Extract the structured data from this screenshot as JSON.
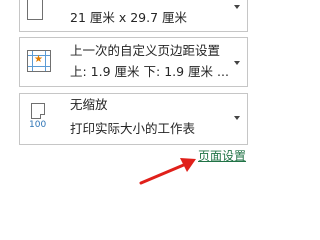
{
  "paper_size": {
    "line1": "21 厘米 x 29.7 厘米"
  },
  "margins": {
    "line1": "上一次的自定义页边距设置",
    "line2": "上: 1.9 厘米 下: 1.9 厘米 ..."
  },
  "scaling": {
    "line1": "无缩放",
    "line2": "打印实际大小的工作表",
    "icon_label": "100"
  },
  "page_setup_link": {
    "label": "页面设置"
  },
  "colors": {
    "link": "#217346",
    "arrow": "#e0201a",
    "border": "#c6c6c6"
  },
  "icons": {
    "paper": "paper-size-icon",
    "margins": "custom-margins-icon",
    "scaling": "no-scaling-icon",
    "caret": "chevron-down-icon"
  }
}
